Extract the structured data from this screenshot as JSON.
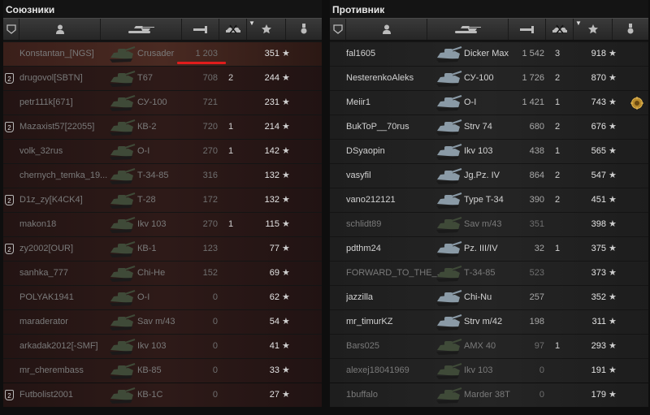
{
  "left": {
    "title": "Союзники",
    "rows": [
      {
        "plat": false,
        "name": "Konstantan_[NGS]",
        "tank": "Crusader",
        "dmg": "1 203",
        "kills": "",
        "score": "351",
        "dead": true,
        "self": true
      },
      {
        "plat": true,
        "name": "drugovol[SBTN]",
        "tank": "T67",
        "dmg": "708",
        "kills": "2",
        "score": "244",
        "dead": true
      },
      {
        "plat": false,
        "name": "petr111k[671]",
        "tank": "СУ-100",
        "dmg": "721",
        "kills": "",
        "score": "231",
        "dead": true
      },
      {
        "plat": true,
        "name": "Mazaxist57[22055]",
        "tank": "КВ-2",
        "dmg": "720",
        "kills": "1",
        "score": "214",
        "dead": true
      },
      {
        "plat": false,
        "name": "volk_32rus",
        "tank": "O-I",
        "dmg": "270",
        "kills": "1",
        "score": "142",
        "dead": true
      },
      {
        "plat": false,
        "name": "chernych_temka_19...",
        "tank": "Т-34-85",
        "dmg": "316",
        "kills": "",
        "score": "132",
        "dead": true
      },
      {
        "plat": true,
        "name": "D1z_zy[K4CK4]",
        "tank": "Т-28",
        "dmg": "172",
        "kills": "",
        "score": "132",
        "dead": true
      },
      {
        "plat": false,
        "name": "makon18",
        "tank": "Ikv 103",
        "dmg": "270",
        "kills": "1",
        "score": "115",
        "dead": true
      },
      {
        "plat": true,
        "name": "zy2002[OUR]",
        "tank": "КВ-1",
        "dmg": "123",
        "kills": "",
        "score": "77",
        "dead": true
      },
      {
        "plat": false,
        "name": "sanhka_777",
        "tank": "Chi-He",
        "dmg": "152",
        "kills": "",
        "score": "69",
        "dead": true
      },
      {
        "plat": false,
        "name": "POLYAK1941",
        "tank": "O-I",
        "dmg": "0",
        "kills": "",
        "score": "62",
        "dead": true
      },
      {
        "plat": false,
        "name": "maraderator",
        "tank": "Sav m/43",
        "dmg": "0",
        "kills": "",
        "score": "54",
        "dead": true
      },
      {
        "plat": false,
        "name": "arkadak2012[-SMF]",
        "tank": "Ikv 103",
        "dmg": "0",
        "kills": "",
        "score": "41",
        "dead": true
      },
      {
        "plat": false,
        "name": "mr_cherembass",
        "tank": "КВ-85",
        "dmg": "0",
        "kills": "",
        "score": "33",
        "dead": true
      },
      {
        "plat": true,
        "name": "Futbolist2001",
        "tank": "КВ-1С",
        "dmg": "0",
        "kills": "",
        "score": "27",
        "dead": true
      }
    ]
  },
  "right": {
    "title": "Противник",
    "rows": [
      {
        "plat": false,
        "name": "fal1605",
        "tank": "Dicker Max",
        "dmg": "1 542",
        "kills": "3",
        "score": "918",
        "dead": false
      },
      {
        "plat": false,
        "name": "NesterenkoAleks",
        "tank": "СУ-100",
        "dmg": "1 726",
        "kills": "2",
        "score": "870",
        "dead": false
      },
      {
        "plat": false,
        "name": "Meiir1",
        "tank": "O-I",
        "dmg": "1 421",
        "kills": "1",
        "score": "743",
        "dead": false,
        "medal": true
      },
      {
        "plat": false,
        "name": "BukToP__70rus",
        "tank": "Strv 74",
        "dmg": "680",
        "kills": "2",
        "score": "676",
        "dead": false
      },
      {
        "plat": false,
        "name": "DSyaopin",
        "tank": "Ikv 103",
        "dmg": "438",
        "kills": "1",
        "score": "565",
        "dead": false
      },
      {
        "plat": false,
        "name": "vasyfil",
        "tank": "Jg.Pz. IV",
        "dmg": "864",
        "kills": "2",
        "score": "547",
        "dead": false
      },
      {
        "plat": false,
        "name": "vano212121",
        "tank": "Type T-34",
        "dmg": "390",
        "kills": "2",
        "score": "451",
        "dead": false
      },
      {
        "plat": false,
        "name": "schlidt89",
        "tank": "Sav m/43",
        "dmg": "351",
        "kills": "",
        "score": "398",
        "dead": true
      },
      {
        "plat": false,
        "name": "pdthm24",
        "tank": "Pz. III/IV",
        "dmg": "32",
        "kills": "1",
        "score": "375",
        "dead": false
      },
      {
        "plat": false,
        "name": "FORWARD_TO_THE_...",
        "tank": "Т-34-85",
        "dmg": "523",
        "kills": "",
        "score": "373",
        "dead": true
      },
      {
        "plat": false,
        "name": "jazzilla",
        "tank": "Chi-Nu",
        "dmg": "257",
        "kills": "",
        "score": "352",
        "dead": false
      },
      {
        "plat": false,
        "name": "mr_timurKZ",
        "tank": "Strv m/42",
        "dmg": "198",
        "kills": "",
        "score": "311",
        "dead": false
      },
      {
        "plat": false,
        "name": "Bars025",
        "tank": "AMX 40",
        "dmg": "97",
        "kills": "1",
        "score": "293",
        "dead": true
      },
      {
        "plat": false,
        "name": "alexej18041969",
        "tank": "Ikv 103",
        "dmg": "0",
        "kills": "",
        "score": "191",
        "dead": true
      },
      {
        "plat": false,
        "name": "1buffalo",
        "tank": "Marder 38T",
        "dmg": "0",
        "kills": "",
        "score": "179",
        "dead": true
      }
    ]
  },
  "icons": {
    "platoon": "platoon-icon",
    "player": "player-icon",
    "vehicle": "vehicle-icon",
    "damage": "damage-icon",
    "kills": "kills-icon",
    "score": "star-icon",
    "medal": "medal-icon"
  },
  "colors": {
    "ally_row": "#2e1a18",
    "enemy_row": "#252525",
    "highlight": "#e01c1c"
  },
  "platoon_glyph": "2",
  "star_glyph": "★"
}
